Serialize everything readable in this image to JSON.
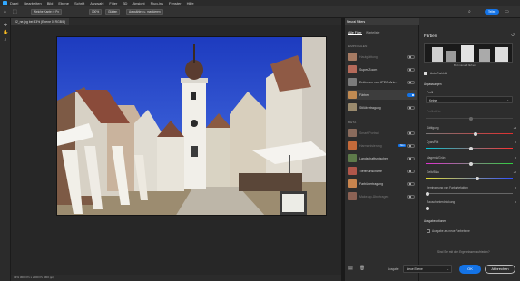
{
  "menu": [
    "Datei",
    "Bearbeiten",
    "Bild",
    "Ebene",
    "Schrift",
    "Auswahl",
    "Filter",
    "3D",
    "Ansicht",
    "Plug-ins",
    "Fenster",
    "Hilfe"
  ],
  "options": {
    "field1": "Weiche Kante: 0 Px",
    "checkbox_label": "Glätten",
    "field2": "100%",
    "select_btn": "Auswählen u. maskieren",
    "share_btn": "Teilen"
  },
  "document": {
    "tab": "02_ne.jpg bei 33% (Ebene 0, RGB/8)",
    "status": "33%   3000 Px x 2000 Px (300 ppi)"
  },
  "filter_panel": {
    "header": "Neural Filters",
    "tab_all": "Alle Filter",
    "tab_wait": "Wartelis­te",
    "section_featured": "EMPFOHLEN",
    "section_beta": "BETA",
    "featured": [
      {
        "label": "Hautglättung",
        "enabled": false,
        "dim": true
      },
      {
        "label": "Super Zoom",
        "enabled": false,
        "dim": false
      },
      {
        "label": "Entfernen von JPEG-Arte...",
        "enabled": false,
        "dim": false
      },
      {
        "label": "Färben",
        "enabled": true,
        "dim": false
      },
      {
        "label": "Stilübertragung",
        "enabled": false,
        "dim": false
      }
    ],
    "beta": [
      {
        "label": "Smart Portrait",
        "enabled": false,
        "dim": true
      },
      {
        "label": "Harmonisierung",
        "enabled": false,
        "dim": true,
        "badge": "Neu"
      },
      {
        "label": "Landschaftsmischer",
        "enabled": false,
        "dim": false
      },
      {
        "label": "Tiefenunschärfe",
        "enabled": false,
        "dim": false
      },
      {
        "label": "Farbübertragung",
        "enabled": false,
        "dim": false
      },
      {
        "label": "Make-up-Übertragen",
        "enabled": false,
        "dim": true
      }
    ]
  },
  "settings": {
    "title": "Färben",
    "preview_caption": "Bild manuell färben",
    "auto_color": "Auto-Farbbild",
    "adjustments": "Anpassungen",
    "profile_label": "Profil",
    "profile_value": "Keine",
    "strength_label": "Profilstärke",
    "sliders": [
      {
        "label": "Sättigung",
        "value": "+3",
        "pos": 0.55
      },
      {
        "label": "Cyan/Rot",
        "value": "0",
        "pos": 0.5
      },
      {
        "label": "Magenta/Grün",
        "value": "0",
        "pos": 0.5
      },
      {
        "label": "Gelb/Blau",
        "value": "+2",
        "pos": 0.57
      },
      {
        "label": "Verringerung von Farbartefakten",
        "value": "0",
        "pos": 0.0
      },
      {
        "label": "Rauschunterdrückung",
        "value": "0",
        "pos": 0.0
      }
    ],
    "output_section": "Ausgabeoptionen",
    "output_check": "Ausgabe als neue Farbebene",
    "feedback": "Sind Sie mit den Ergebnissen zufrieden?",
    "output_label": "Ausgabe",
    "output_value": "Neue Ebene",
    "ok": "OK",
    "cancel": "Abbrechen"
  },
  "colors": {
    "accent": "#1473e6",
    "panel": "#2d2d2d",
    "sky": "#2a4fd6"
  }
}
